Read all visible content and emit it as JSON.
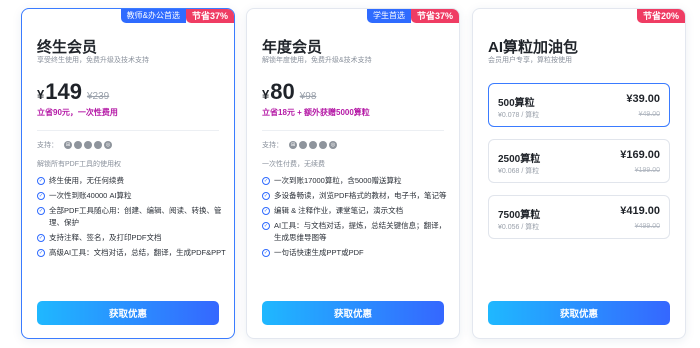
{
  "plans": [
    {
      "badge_primary": "教师&办公首选",
      "badge_discount": "节省37%",
      "title": "终生会员",
      "subtitle": "享受终生使用，免费升级及技术支持",
      "currency": "¥",
      "price": "149",
      "original_price": "¥239",
      "promo": "立省90元，一次性费用",
      "support_label": "支持：",
      "note": "解锁所有PDF工具的使用权",
      "features": [
        "终生使用，无任何续费",
        "一次性到账40000 AI算粒",
        "全部PDF工具随心用：创建、编辑、阅读、转换、管理、保护",
        "支持注释、签名，及打印PDF文档",
        "高级AI工具：文档对话，总结，翻译，生成PDF&PPT"
      ],
      "cta": "获取优惠"
    },
    {
      "badge_primary": "学生首选",
      "badge_discount": "节省37%",
      "title": "年度会员",
      "subtitle": "解锁年度使用，免费升级&技术支持",
      "currency": "¥",
      "price": "80",
      "original_price": "¥98",
      "promo": "立省18元 + 额外获赠5000算粒",
      "support_label": "支持：",
      "note": "一次性付费，无续费",
      "features": [
        "一次到账17000算粒，含5000赠送算粒",
        "多设备畅读，浏览PDF格式的教材，电子书，笔记等",
        "编辑 & 注释作业，课堂笔记，演示文档",
        "AI工具：与文档对话，提炼，总结关键信息；翻译，生成思维导图等",
        "一句话快速生成PPT或PDF"
      ],
      "cta": "获取优惠"
    },
    {
      "badge_discount": "节省20%",
      "title": "AI算粒加油包",
      "subtitle": "会员用户专享，算粒按使用",
      "options": [
        {
          "name": "500算粒",
          "unit": "¥0.078 / 算粒",
          "price": "¥39.00",
          "original": "¥49.00"
        },
        {
          "name": "2500算粒",
          "unit": "¥0.068 / 算粒",
          "price": "¥169.00",
          "original": "¥199.00"
        },
        {
          "name": "7500算粒",
          "unit": "¥0.056 / 算粒",
          "price": "¥419.00",
          "original": "¥499.00"
        }
      ],
      "cta": "获取优惠"
    }
  ],
  "platform_icons": [
    "windows-icon",
    "apple-icon",
    "android-icon",
    "ios-icon",
    "web-icon"
  ],
  "colors": {
    "accent": "#2f6bff",
    "discount": "#ef3c63",
    "promo": "#b51aa6",
    "cta_start": "#1fb8ff",
    "cta_end": "#3567ff"
  }
}
